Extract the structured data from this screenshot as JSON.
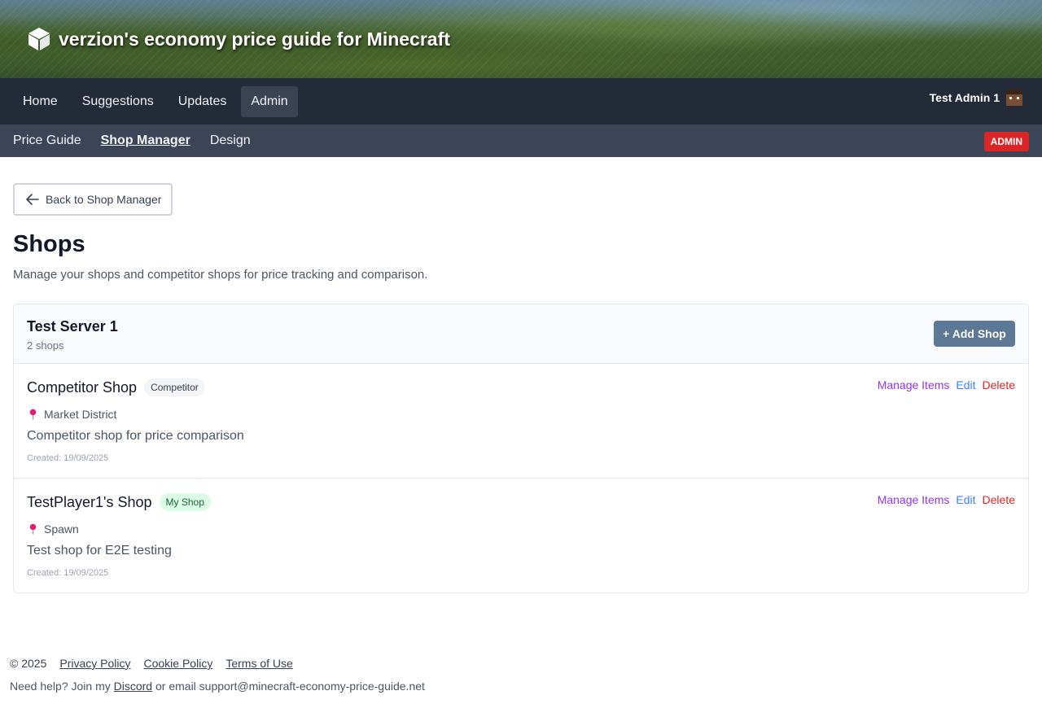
{
  "banner": {
    "title": "verzion's economy price guide for Minecraft",
    "icon": "cube-icon"
  },
  "nav": {
    "items": [
      {
        "label": "Home",
        "active": false
      },
      {
        "label": "Suggestions",
        "active": false
      },
      {
        "label": "Updates",
        "active": false
      },
      {
        "label": "Admin",
        "active": true
      }
    ],
    "user": {
      "name": "Test Admin 1",
      "avatar": "steve-avatar-icon"
    }
  },
  "subnav": {
    "items": [
      {
        "label": "Price Guide",
        "active": false
      },
      {
        "label": "Shop Manager",
        "active": true
      },
      {
        "label": "Design",
        "active": false
      }
    ],
    "badge": "ADMIN"
  },
  "page": {
    "back_label": "Back to Shop Manager",
    "title": "Shops",
    "description": "Manage your shops and competitor shops for price tracking and comparison."
  },
  "server": {
    "name": "Test Server 1",
    "count": "2 shops",
    "add_label": "+ Add Shop",
    "shops": [
      {
        "name": "Competitor Shop",
        "tag": "Competitor",
        "location": "Market District",
        "description": "Competitor shop for price comparison",
        "created": "Created: 19/09/2025"
      },
      {
        "name": "TestPlayer1's Shop",
        "tag": "My Shop",
        "location": "Spawn",
        "description": "Test shop for E2E testing",
        "created": "Created: 19/09/2025"
      }
    ],
    "actions": {
      "manage": "Manage Items",
      "edit": "Edit",
      "delete": "Delete"
    }
  },
  "footer": {
    "copyright": "© 2025",
    "links": [
      "Privacy Policy",
      "Cookie Policy",
      "Terms of Use"
    ],
    "help_prefix": "Need help? Join my",
    "discord": "Discord",
    "help_suffix": "or email support@minecraft-economy-price-guide.net"
  },
  "colors": {
    "nav_bg": "#232a38",
    "subnav_bg": "#3c4557",
    "admin_badge": "#dc2626",
    "add_button": "#5d7894",
    "manage_link": "#9333ea",
    "edit_link": "#3b82f6",
    "delete_link": "#dc2626"
  }
}
